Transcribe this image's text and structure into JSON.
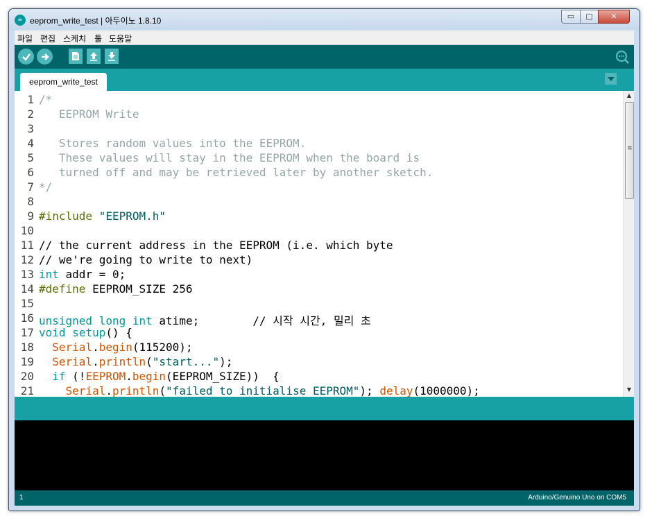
{
  "window": {
    "title": "eeprom_write_test | 아두이노 1.8.10",
    "min_glyph": "▭",
    "max_glyph": "▢",
    "close_glyph": "✕"
  },
  "menu": [
    "파일",
    "편집",
    "스케치",
    "툴",
    "도움말"
  ],
  "toolbar": {
    "buttons": [
      {
        "name": "verify-icon"
      },
      {
        "name": "upload-icon"
      },
      {
        "name": "new-icon"
      },
      {
        "name": "open-icon"
      },
      {
        "name": "save-icon"
      },
      {
        "name": "serial-monitor-icon"
      }
    ]
  },
  "tabs": {
    "active": "eeprom_write_test",
    "menu_icon": "chevron-down-icon"
  },
  "editor": {
    "lines": [
      [
        [
          "c-comment",
          "/*"
        ]
      ],
      [
        [
          "c-comment",
          "   EEPROM Write"
        ]
      ],
      [],
      [
        [
          "c-comment",
          "   Stores random values into the EEPROM."
        ]
      ],
      [
        [
          "c-comment",
          "   These values will stay in the EEPROM when the board is"
        ]
      ],
      [
        [
          "c-comment",
          "   turned off and may be retrieved later by another sketch."
        ]
      ],
      [
        [
          "c-comment",
          "*/"
        ]
      ],
      [],
      [
        [
          "c-pre",
          "#include "
        ],
        [
          "c-str",
          "\"EEPROM.h\""
        ]
      ],
      [],
      [
        [
          "c-plain",
          "// the current address in the EEPROM (i.e. which byte"
        ]
      ],
      [
        [
          "c-plain",
          "// we're going to write to next)"
        ]
      ],
      [
        [
          "c-kw",
          "int"
        ],
        [
          "c-plain",
          " addr = 0;"
        ]
      ],
      [
        [
          "c-pre",
          "#define"
        ],
        [
          "c-plain",
          " EEPROM_SIZE 256"
        ]
      ],
      [],
      [
        [
          "c-kw",
          "unsigned"
        ],
        [
          "c-plain",
          " "
        ],
        [
          "c-kw",
          "long"
        ],
        [
          "c-plain",
          " "
        ],
        [
          "c-kw",
          "int"
        ],
        [
          "c-plain",
          " atime;        // 시작 시간, 밀리 초"
        ]
      ],
      [
        [
          "c-kw",
          "void"
        ],
        [
          "c-plain",
          " "
        ],
        [
          "c-kw",
          "setup"
        ],
        [
          "c-plain",
          "() {"
        ]
      ],
      [
        [
          "c-plain",
          "  "
        ],
        [
          "c-fn",
          "Serial"
        ],
        [
          "c-plain",
          "."
        ],
        [
          "c-fn",
          "begin"
        ],
        [
          "c-plain",
          "(115200);"
        ]
      ],
      [
        [
          "c-plain",
          "  "
        ],
        [
          "c-fn",
          "Serial"
        ],
        [
          "c-plain",
          "."
        ],
        [
          "c-fn",
          "println"
        ],
        [
          "c-plain",
          "("
        ],
        [
          "c-str",
          "\"start...\""
        ],
        [
          "c-plain",
          ");"
        ]
      ],
      [
        [
          "c-plain",
          "  "
        ],
        [
          "c-kw",
          "if"
        ],
        [
          "c-plain",
          " (!"
        ],
        [
          "c-fn",
          "EEPROM"
        ],
        [
          "c-plain",
          "."
        ],
        [
          "c-fn",
          "begin"
        ],
        [
          "c-plain",
          "(EEPROM_SIZE))  {"
        ]
      ],
      [
        [
          "c-plain",
          "    "
        ],
        [
          "c-fn",
          "Serial"
        ],
        [
          "c-plain",
          "."
        ],
        [
          "c-fn",
          "println"
        ],
        [
          "c-plain",
          "("
        ],
        [
          "c-str",
          "\"failed to initialise EEPROM\""
        ],
        [
          "c-plain",
          "); "
        ],
        [
          "c-fn",
          "delay"
        ],
        [
          "c-plain",
          "(1000000);"
        ]
      ]
    ]
  },
  "status": {
    "line_number": "1",
    "board": "Arduino/Genuino Uno on COM5"
  },
  "colors": {
    "toolbar": "#006468",
    "tabbar": "#17a1a5",
    "button": "#4db7bb",
    "console": "#000000"
  }
}
